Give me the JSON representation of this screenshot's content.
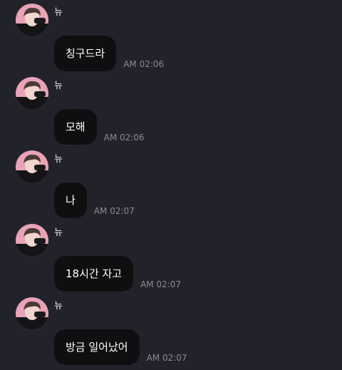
{
  "messages": [
    {
      "sender": "뉴",
      "text": "칭구드라",
      "time": "AM 02:06"
    },
    {
      "sender": "뉴",
      "text": "모해",
      "time": "AM 02:06"
    },
    {
      "sender": "뉴",
      "text": "나",
      "time": "AM 02:07"
    },
    {
      "sender": "뉴",
      "text": "18시간 자고",
      "time": "AM 02:07"
    },
    {
      "sender": "뉴",
      "text": "방금 일어났어",
      "time": "AM 02:07"
    }
  ],
  "colors": {
    "background": "#22222b",
    "bubble": "#0f0f12",
    "avatar_accent": "#e8a3b8"
  },
  "icons": {
    "avatar": "profile-photo"
  }
}
